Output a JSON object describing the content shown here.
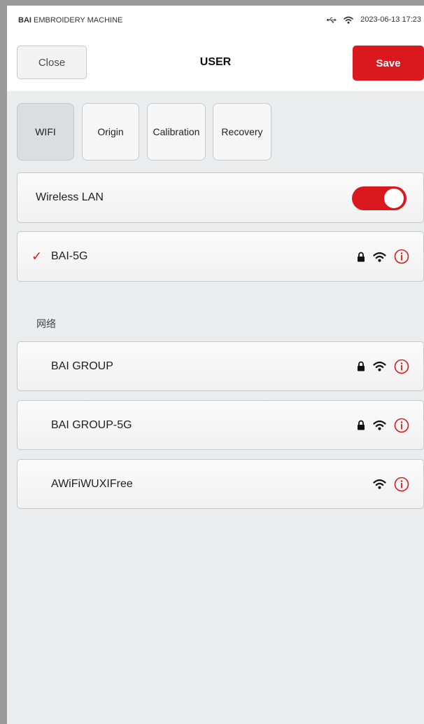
{
  "status": {
    "brand": "BAI",
    "app_name": "EMBROIDERY MACHINE",
    "usb_icon": "usb-icon",
    "wifi_icon": "wifi-icon",
    "datetime": "2023-06-13 17:23"
  },
  "header": {
    "close_label": "Close",
    "title": "USER",
    "save_label": "Save"
  },
  "tabs": [
    {
      "label": "WIFI",
      "active": true
    },
    {
      "label": "Origin",
      "active": false
    },
    {
      "label": "Calibration",
      "active": false
    },
    {
      "label": "Recovery",
      "active": false
    }
  ],
  "wireless": {
    "label": "Wireless LAN",
    "enabled": true
  },
  "connected": {
    "check_glyph": "✓",
    "name": "BAI-5G",
    "secured": true
  },
  "networks_label": "网络",
  "networks": [
    {
      "name": "BAI GROUP",
      "secured": true
    },
    {
      "name": "BAI GROUP-5G",
      "secured": true
    },
    {
      "name": "AWiFiWUXIFree",
      "secured": false
    }
  ],
  "colors": {
    "accent": "#d9191e",
    "background": "#ebecee",
    "card": "#f5f5f5"
  }
}
